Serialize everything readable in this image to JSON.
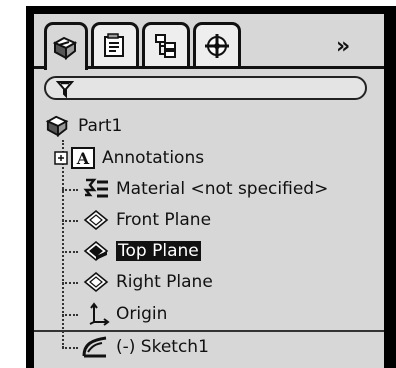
{
  "tabs": [
    {
      "name": "featuremanager",
      "icon": "featuremanager-icon",
      "active": true
    },
    {
      "name": "propertymanager",
      "icon": "propertymanager-icon",
      "active": false
    },
    {
      "name": "configurationmanager",
      "icon": "configurationmanager-icon",
      "active": false
    },
    {
      "name": "dimxpertmanager",
      "icon": "dimxpertmanager-icon",
      "active": false
    }
  ],
  "overflow_label": "»",
  "filter": {
    "icon": "filter-icon",
    "value": ""
  },
  "tree": {
    "root": {
      "label": "Part1",
      "icon": "part-icon"
    },
    "items": [
      {
        "label": "Annotations",
        "icon": "annotations-icon",
        "expander": "plus"
      },
      {
        "label": "Material <not specified>",
        "icon": "material-icon"
      },
      {
        "label": "Front Plane",
        "icon": "plane-icon"
      },
      {
        "label": "Top Plane",
        "icon": "plane-icon",
        "selected": true
      },
      {
        "label": "Right Plane",
        "icon": "plane-icon"
      },
      {
        "label": "Origin",
        "icon": "origin-icon"
      },
      {
        "label": "(-) Sketch1",
        "icon": "sketch-icon"
      }
    ]
  },
  "colors": {
    "panel_bg": "#d7d7d7",
    "selection_bg": "#111111",
    "selection_text": "#ffffff"
  }
}
